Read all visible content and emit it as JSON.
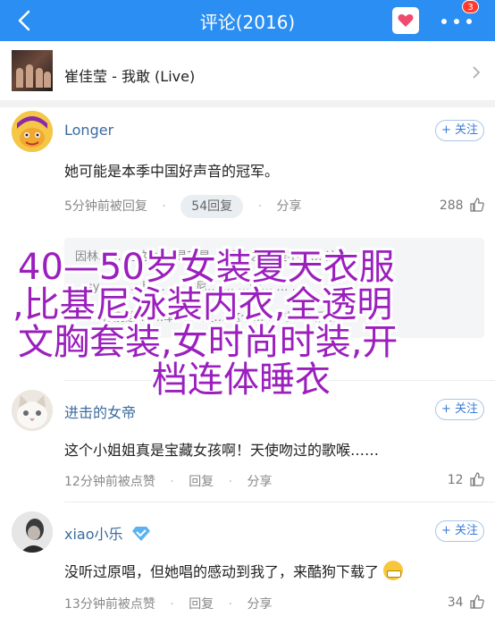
{
  "header": {
    "title": "评论(2016)",
    "badge": "3"
  },
  "song": {
    "title": "崔佳莹 - 我敢 (Live)"
  },
  "comments": [
    {
      "user": "Longer",
      "follow": "+ 关注",
      "text": "她可能是本季中国好声音的冠军。",
      "time": "5分钟前被回复",
      "reply_pill": "54回复",
      "share": "分享",
      "likes": "288"
    },
    {
      "user": "进击的女帝",
      "follow": "+ 关注",
      "text": "这个小姐姐真是宝藏女孩啊！天使吻过的歌喉……",
      "time": "12分钟前被点赞",
      "reply": "回复",
      "share": "分享",
      "likes": "12"
    },
    {
      "user": "xiao小乐",
      "follow": "+ 关注",
      "text": "没听过原唱，但她唱的感动到我了，来酷狗下载了",
      "time": "13分钟前被点赞",
      "reply": "回复",
      "share": "分享",
      "likes": "34"
    }
  ],
  "reply_fragments": [
    "因林…  …是这么… 是不是… 就像之… 是不是… 这…",
    "…sy… …  …比… …  …尼… … …全… …  …",
    "… …你别这… …卓… …定… 这个… …时… 后面还…"
  ],
  "overlay": {
    "lines": [
      "40—50岁女装夏天衣服",
      ",比基尼泳装内衣,全透明",
      "文胸套装,女时尚时装,开",
      "档连体睡衣"
    ]
  },
  "colors": {
    "header": "#2a8ef3",
    "overlay_text": "#9b1fbd",
    "username": "#3a6b9e"
  }
}
